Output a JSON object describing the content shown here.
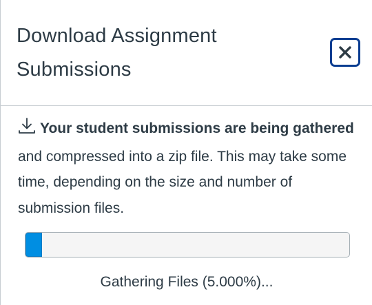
{
  "dialog": {
    "title": "Download Assignment Submissions",
    "close_icon": "close-icon"
  },
  "message": {
    "icon": "download-icon",
    "bold_text": "Your student submissions are being gathered",
    "rest_text": " and compressed into a zip file. This may take some time, depending on the size and number of submission files."
  },
  "progress": {
    "percent": 5.0,
    "label": "Gathering Files (5.000%)..."
  },
  "colors": {
    "accent": "#008ee2",
    "focus_ring": "#0b3d91",
    "text": "#2d3b45",
    "divider": "#c7cdd1"
  }
}
